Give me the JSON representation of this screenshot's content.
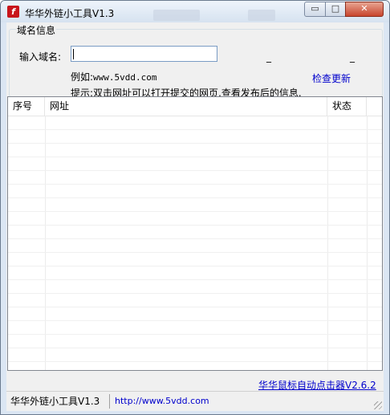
{
  "window": {
    "title": "华华外链小工具V1.3",
    "buttons": {
      "minimize": "▭",
      "maximize": "□",
      "close": "✕"
    }
  },
  "domain_group": {
    "title": "域名信息",
    "input_label": "输入域名:",
    "input_value": "",
    "dash_left": "_",
    "dash_right": "_",
    "example_prefix": "例如:",
    "example_value": "www.5vdd.com",
    "update_link": "检查更新",
    "hint": "提示:双击网址可以打开提交的网页,查看发布后的信息."
  },
  "list": {
    "columns": [
      "序号",
      "网址",
      "状态"
    ],
    "rows": []
  },
  "footer_link": "华华鼠标自动点击器V2.6.2",
  "statusbar": {
    "pane1": "华华外链小工具V1.3",
    "pane2": "http://www.5vdd.com"
  },
  "colors": {
    "link": "#0000cc",
    "app_icon": "#c8151b",
    "close_button": "#c8452d"
  },
  "icons": {
    "app": "flash-icon"
  }
}
